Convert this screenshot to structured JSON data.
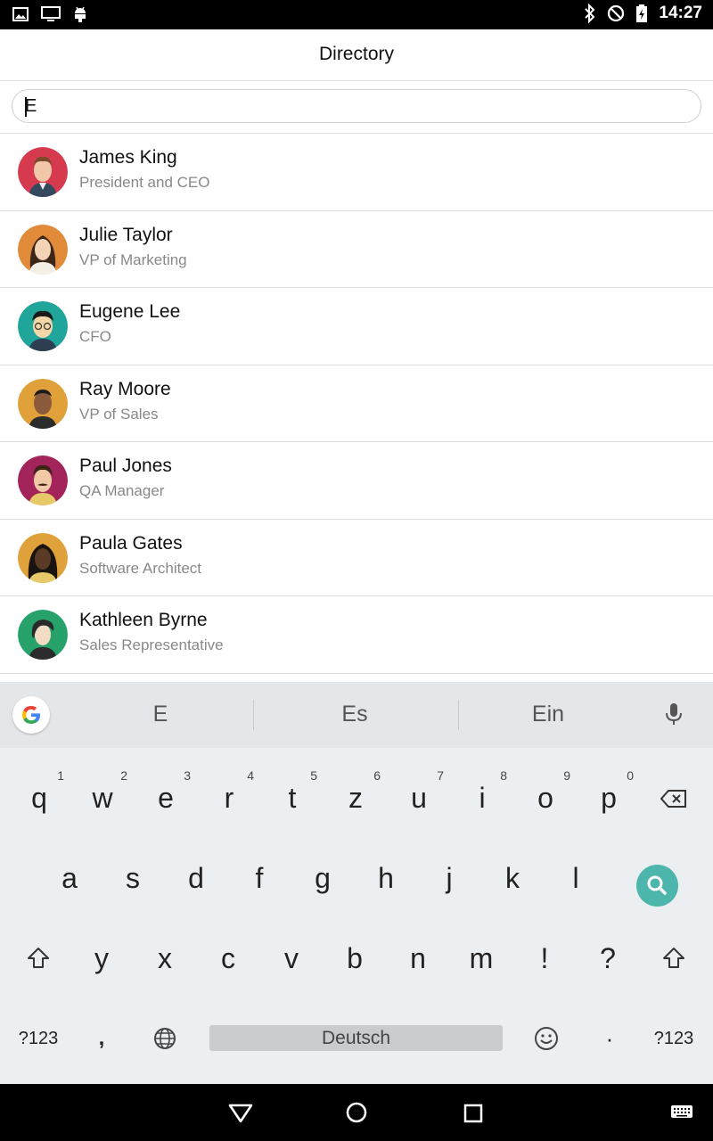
{
  "status_bar": {
    "time": "14:27",
    "left_icons": [
      "image-icon",
      "monitor-icon",
      "android-icon"
    ],
    "right_icons": [
      "bluetooth-icon",
      "do-not-disturb-icon",
      "battery-charging-icon"
    ]
  },
  "header": {
    "title": "Directory"
  },
  "search": {
    "value": "E",
    "placeholder": ""
  },
  "contacts": [
    {
      "name": "James King",
      "title": "President and CEO",
      "avatar_color": "#d63a4e"
    },
    {
      "name": "Julie Taylor",
      "title": "VP of Marketing",
      "avatar_color": "#e08a3a"
    },
    {
      "name": "Eugene Lee",
      "title": "CFO",
      "avatar_color": "#1fa59a"
    },
    {
      "name": "Ray Moore",
      "title": "VP of Sales",
      "avatar_color": "#e0a13a"
    },
    {
      "name": "Paul Jones",
      "title": "QA Manager",
      "avatar_color": "#a3245a"
    },
    {
      "name": "Paula Gates",
      "title": "Software Architect",
      "avatar_color": "#e0a13a"
    },
    {
      "name": "Kathleen Byrne",
      "title": "Sales Representative",
      "avatar_color": "#26a26a"
    }
  ],
  "keyboard": {
    "suggestions": [
      "E",
      "Es",
      "Ein"
    ],
    "row1": [
      "q",
      "w",
      "e",
      "r",
      "t",
      "z",
      "u",
      "i",
      "o",
      "p"
    ],
    "row1_hints": [
      "1",
      "2",
      "3",
      "4",
      "5",
      "6",
      "7",
      "8",
      "9",
      "0"
    ],
    "row2": [
      "a",
      "s",
      "d",
      "f",
      "g",
      "h",
      "j",
      "k",
      "l"
    ],
    "row3": [
      "y",
      "x",
      "c",
      "v",
      "b",
      "n",
      "m",
      "!",
      "?"
    ],
    "symbols_label": "?123",
    "comma_label": ",",
    "period_label": "·",
    "space_label": "Deutsch",
    "accent_color": "#4db6ac"
  },
  "nav_bar": {
    "icons": [
      "back-icon",
      "home-icon",
      "recents-icon",
      "keyboard-switch-icon"
    ]
  }
}
